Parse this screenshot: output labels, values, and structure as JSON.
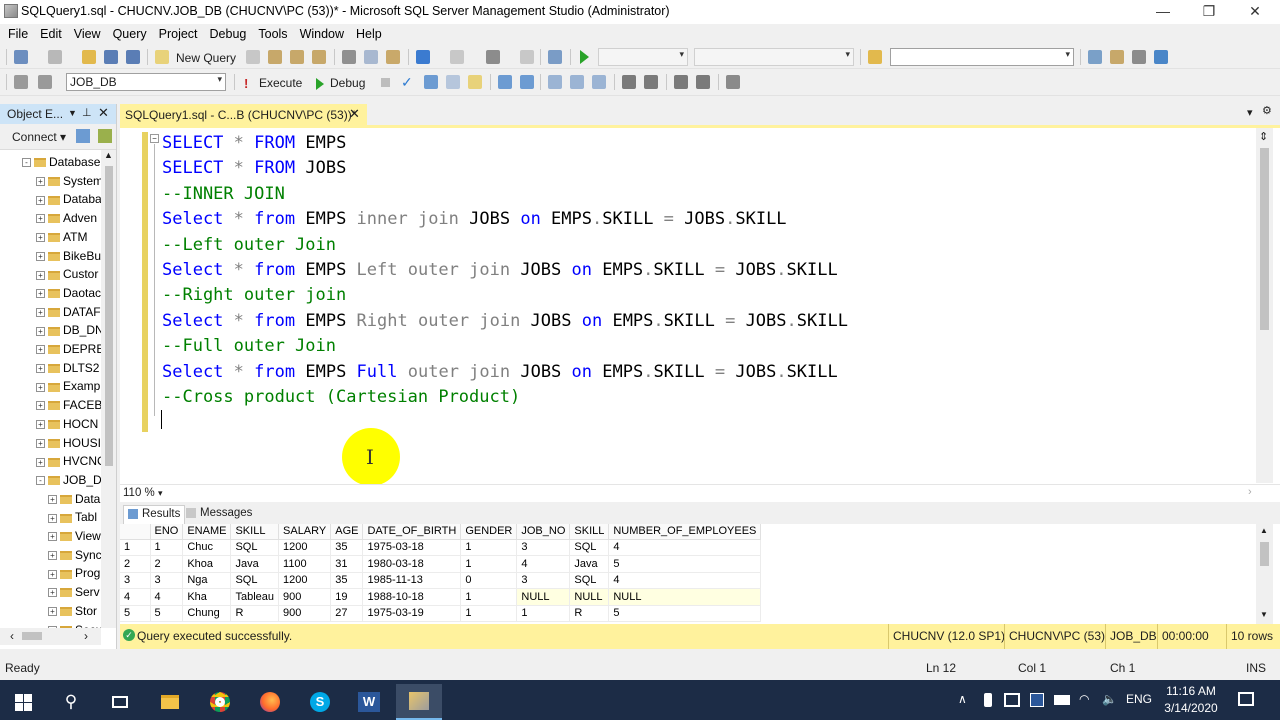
{
  "window": {
    "title": "SQLQuery1.sql - CHUCNV.JOB_DB (CHUCNV\\PC (53))* - Microsoft SQL Server Management Studio (Administrator)",
    "minimize": "—",
    "restore": "❐",
    "close": "✕"
  },
  "menu": [
    "File",
    "Edit",
    "View",
    "Query",
    "Project",
    "Debug",
    "Tools",
    "Window",
    "Help"
  ],
  "toolbar1": {
    "new_query": "New Query"
  },
  "toolbar2": {
    "database": "JOB_DB",
    "execute": "Execute",
    "debug": "Debug"
  },
  "object_explorer": {
    "title": "Object E...",
    "pin": "📌",
    "close": "✕",
    "connect": "Connect",
    "nodes": [
      {
        "label": "Database",
        "state": "-"
      },
      {
        "label": "System",
        "state": "+"
      },
      {
        "label": "Databa",
        "state": "+"
      },
      {
        "label": "Adven",
        "state": "+"
      },
      {
        "label": "ATM",
        "state": "+"
      },
      {
        "label": "BikeBu",
        "state": "+"
      },
      {
        "label": "Custor",
        "state": "+"
      },
      {
        "label": "Daotac",
        "state": "+"
      },
      {
        "label": "DATAF",
        "state": "+"
      },
      {
        "label": "DB_DN",
        "state": "+"
      },
      {
        "label": "DEPRE",
        "state": "+"
      },
      {
        "label": "DLTS2",
        "state": "+"
      },
      {
        "label": "Examp",
        "state": "+"
      },
      {
        "label": "FACEB",
        "state": "+"
      },
      {
        "label": "HOCN",
        "state": "+"
      },
      {
        "label": "HOUSI",
        "state": "+"
      },
      {
        "label": "HVCNC",
        "state": "+"
      },
      {
        "label": "JOB_D",
        "state": "-"
      },
      {
        "label": "Data",
        "state": "+"
      },
      {
        "label": "Tabl",
        "state": "+"
      },
      {
        "label": "View",
        "state": "+"
      },
      {
        "label": "Sync",
        "state": "+"
      },
      {
        "label": "Prog",
        "state": "+"
      },
      {
        "label": "Serv",
        "state": "+"
      },
      {
        "label": "Stor",
        "state": "+"
      },
      {
        "label": "Secu",
        "state": "+"
      }
    ]
  },
  "doc_tab": {
    "label": "SQLQuery1.sql - C...B (CHUCNV\\PC (53))*",
    "close": "✕"
  },
  "editor": {
    "lines": [
      [
        {
          "t": "SELECT",
          "c": "kw"
        },
        {
          "t": " ",
          "c": ""
        },
        {
          "t": "*",
          "c": "gr"
        },
        {
          "t": " ",
          "c": ""
        },
        {
          "t": "FROM",
          "c": "kw"
        },
        {
          "t": " EMPS",
          "c": ""
        }
      ],
      [
        {
          "t": "SELECT",
          "c": "kw"
        },
        {
          "t": " ",
          "c": ""
        },
        {
          "t": "*",
          "c": "gr"
        },
        {
          "t": " ",
          "c": ""
        },
        {
          "t": "FROM",
          "c": "kw"
        },
        {
          "t": " JOBS",
          "c": ""
        }
      ],
      [
        {
          "t": "--INNER JOIN",
          "c": "cm"
        }
      ],
      [
        {
          "t": "Select",
          "c": "kw"
        },
        {
          "t": " ",
          "c": ""
        },
        {
          "t": "*",
          "c": "gr"
        },
        {
          "t": " ",
          "c": ""
        },
        {
          "t": "from",
          "c": "kw"
        },
        {
          "t": " EMPS ",
          "c": ""
        },
        {
          "t": "inner join",
          "c": "gr"
        },
        {
          "t": " JOBS ",
          "c": ""
        },
        {
          "t": "on",
          "c": "kw"
        },
        {
          "t": " EMPS",
          "c": ""
        },
        {
          "t": ".",
          "c": "gr"
        },
        {
          "t": "SKILL ",
          "c": ""
        },
        {
          "t": "=",
          "c": "gr"
        },
        {
          "t": " JOBS",
          "c": ""
        },
        {
          "t": ".",
          "c": "gr"
        },
        {
          "t": "SKILL",
          "c": ""
        }
      ],
      [
        {
          "t": "--Left outer Join",
          "c": "cm"
        }
      ],
      [
        {
          "t": "Select",
          "c": "kw"
        },
        {
          "t": " ",
          "c": ""
        },
        {
          "t": "*",
          "c": "gr"
        },
        {
          "t": " ",
          "c": ""
        },
        {
          "t": "from",
          "c": "kw"
        },
        {
          "t": " EMPS ",
          "c": ""
        },
        {
          "t": "Left outer join",
          "c": "gr"
        },
        {
          "t": " JOBS ",
          "c": ""
        },
        {
          "t": "on",
          "c": "kw"
        },
        {
          "t": " EMPS",
          "c": ""
        },
        {
          "t": ".",
          "c": "gr"
        },
        {
          "t": "SKILL ",
          "c": ""
        },
        {
          "t": "=",
          "c": "gr"
        },
        {
          "t": " JOBS",
          "c": ""
        },
        {
          "t": ".",
          "c": "gr"
        },
        {
          "t": "SKILL",
          "c": ""
        }
      ],
      [
        {
          "t": "--Right outer join",
          "c": "cm"
        }
      ],
      [
        {
          "t": "Select",
          "c": "kw"
        },
        {
          "t": " ",
          "c": ""
        },
        {
          "t": "*",
          "c": "gr"
        },
        {
          "t": " ",
          "c": ""
        },
        {
          "t": "from",
          "c": "kw"
        },
        {
          "t": " EMPS ",
          "c": ""
        },
        {
          "t": "Right outer join",
          "c": "gr"
        },
        {
          "t": " JOBS ",
          "c": ""
        },
        {
          "t": "on",
          "c": "kw"
        },
        {
          "t": " EMPS",
          "c": ""
        },
        {
          "t": ".",
          "c": "gr"
        },
        {
          "t": "SKILL ",
          "c": ""
        },
        {
          "t": "=",
          "c": "gr"
        },
        {
          "t": " JOBS",
          "c": ""
        },
        {
          "t": ".",
          "c": "gr"
        },
        {
          "t": "SKILL",
          "c": ""
        }
      ],
      [
        {
          "t": "--Full outer Join",
          "c": "cm"
        }
      ],
      [
        {
          "t": "Select",
          "c": "kw"
        },
        {
          "t": " ",
          "c": ""
        },
        {
          "t": "*",
          "c": "gr"
        },
        {
          "t": " ",
          "c": ""
        },
        {
          "t": "from",
          "c": "kw"
        },
        {
          "t": " EMPS ",
          "c": ""
        },
        {
          "t": "Full",
          "c": "kw"
        },
        {
          "t": " ",
          "c": ""
        },
        {
          "t": "outer join",
          "c": "gr"
        },
        {
          "t": " JOBS ",
          "c": ""
        },
        {
          "t": "on",
          "c": "kw"
        },
        {
          "t": " EMPS",
          "c": ""
        },
        {
          "t": ".",
          "c": "gr"
        },
        {
          "t": "SKILL ",
          "c": ""
        },
        {
          "t": "=",
          "c": "gr"
        },
        {
          "t": " JOBS",
          "c": ""
        },
        {
          "t": ".",
          "c": "gr"
        },
        {
          "t": "SKILL",
          "c": ""
        }
      ],
      [
        {
          "t": "--Cross product (Cartesian Product)",
          "c": "cm"
        }
      ]
    ]
  },
  "zoom": "110 %",
  "results": {
    "tab_results": "Results",
    "tab_messages": "Messages",
    "columns": [
      "",
      "ENO",
      "ENAME",
      "SKILL",
      "SALARY",
      "AGE",
      "DATE_OF_BIRTH",
      "GENDER",
      "JOB_NO",
      "SKILL",
      "NUMBER_OF_EMPLOYEES"
    ],
    "rows": [
      [
        "1",
        "1",
        "Chuc",
        "SQL",
        "1200",
        "35",
        "1975-03-18",
        "1",
        "3",
        "SQL",
        "4"
      ],
      [
        "2",
        "2",
        "Khoa",
        "Java",
        "1100",
        "31",
        "1980-03-18",
        "1",
        "4",
        "Java",
        "5"
      ],
      [
        "3",
        "3",
        "Nga",
        "SQL",
        "1200",
        "35",
        "1985-11-13",
        "0",
        "3",
        "SQL",
        "4"
      ],
      [
        "4",
        "4",
        "Kha",
        "Tableau",
        "900",
        "19",
        "1988-10-18",
        "1",
        "NULL",
        "NULL",
        "NULL"
      ],
      [
        "5",
        "5",
        "Chung",
        "R",
        "900",
        "27",
        "1975-03-19",
        "1",
        "1",
        "R",
        "5"
      ]
    ]
  },
  "query_status": {
    "message": "Query executed successfully.",
    "server": "CHUCNV (12.0 SP1)",
    "user": "CHUCNV\\PC (53)",
    "db": "JOB_DB",
    "time": "00:00:00",
    "rows": "10 rows"
  },
  "status_bar": {
    "state": "Ready",
    "ln": "Ln 12",
    "col": "Col 1",
    "ch": "Ch 1",
    "mode": "INS"
  },
  "taskbar": {
    "lang": "ENG",
    "time": "11:16 AM",
    "date": "3/14/2020"
  },
  "colors": {
    "accent_yellow": "#fff29d",
    "oe_header": "#cde4f7",
    "taskbar": "#1c2c46",
    "keyword": "#0000ff",
    "comment": "#008000"
  }
}
